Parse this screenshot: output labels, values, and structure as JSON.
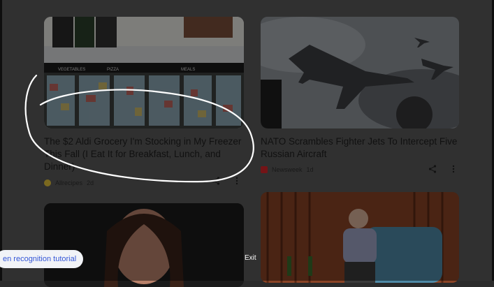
{
  "feed": {
    "cards": [
      {
        "title": "The $2 Aldi Grocery I'm Stocking in My Freezer This Fall (I Eat It for Breakfast, Lunch, and Dinner)",
        "publisher": "Allrecipes",
        "time": "2d",
        "store_signs": [
          "VEGETABLES",
          "PIZZA",
          "MEALS"
        ]
      },
      {
        "title": "NATO Scrambles Fighter Jets To Intercept Five Russian Aircraft",
        "publisher": "Newsweek",
        "time": "1d"
      }
    ]
  },
  "overlay": {
    "tutorial_label": "en recognition tutorial",
    "exit_label": "Exit"
  },
  "colors": {
    "accent": "#3557d7",
    "scribble": "#ffffff",
    "newsweek_red": "#d6262b"
  },
  "icons": [
    "share-icon",
    "more-vert-icon",
    "newsweek-logo-icon"
  ]
}
